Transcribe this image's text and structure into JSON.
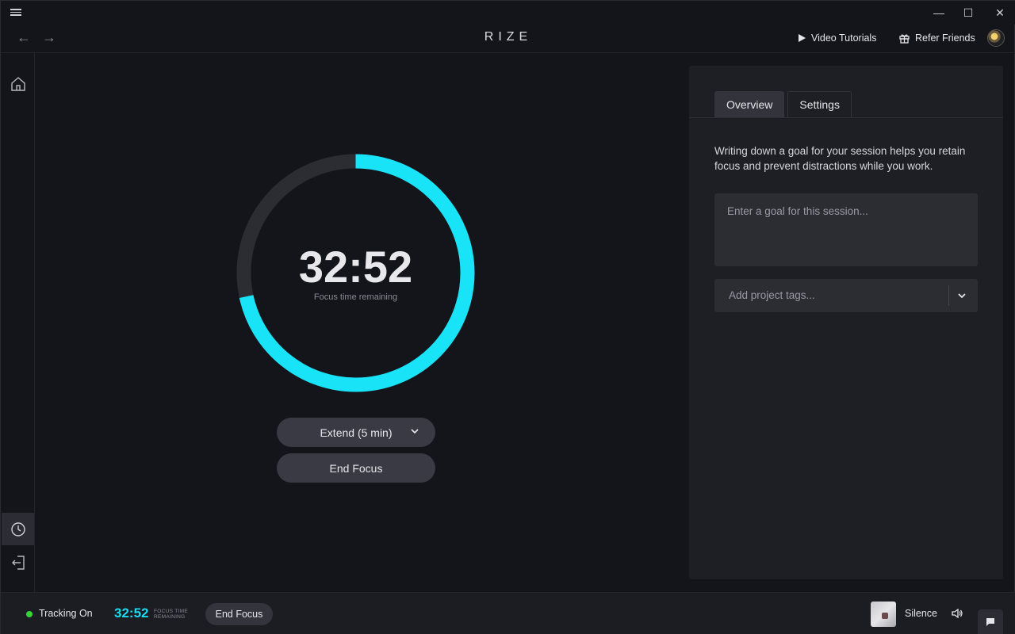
{
  "app": {
    "brand": "RIZE"
  },
  "header": {
    "video_tutorials": "Video Tutorials",
    "refer_friends": "Refer Friends"
  },
  "timer": {
    "time": "32:52",
    "label": "Focus time remaining",
    "progress_remaining_fraction": 0.716,
    "ring_color": "#19e3f7",
    "track_color": "#2c2c33"
  },
  "actions": {
    "extend": "Extend (5 min)",
    "end_focus": "End Focus"
  },
  "panel": {
    "tabs": [
      {
        "label": "Overview",
        "active": true
      },
      {
        "label": "Settings",
        "active": false
      }
    ],
    "description": "Writing down a goal for your session helps you retain focus and prevent distractions while you work.",
    "goal_placeholder": "Enter a goal for this session...",
    "tags_placeholder": "Add project tags..."
  },
  "footer": {
    "tracking": "Tracking On",
    "time": "32:52",
    "time_label_1": "FOCUS TIME",
    "time_label_2": "REMAINING",
    "end_focus": "End Focus",
    "sound": "Silence"
  },
  "colors": {
    "accent": "#19dcf5",
    "status_on": "#35d435"
  }
}
